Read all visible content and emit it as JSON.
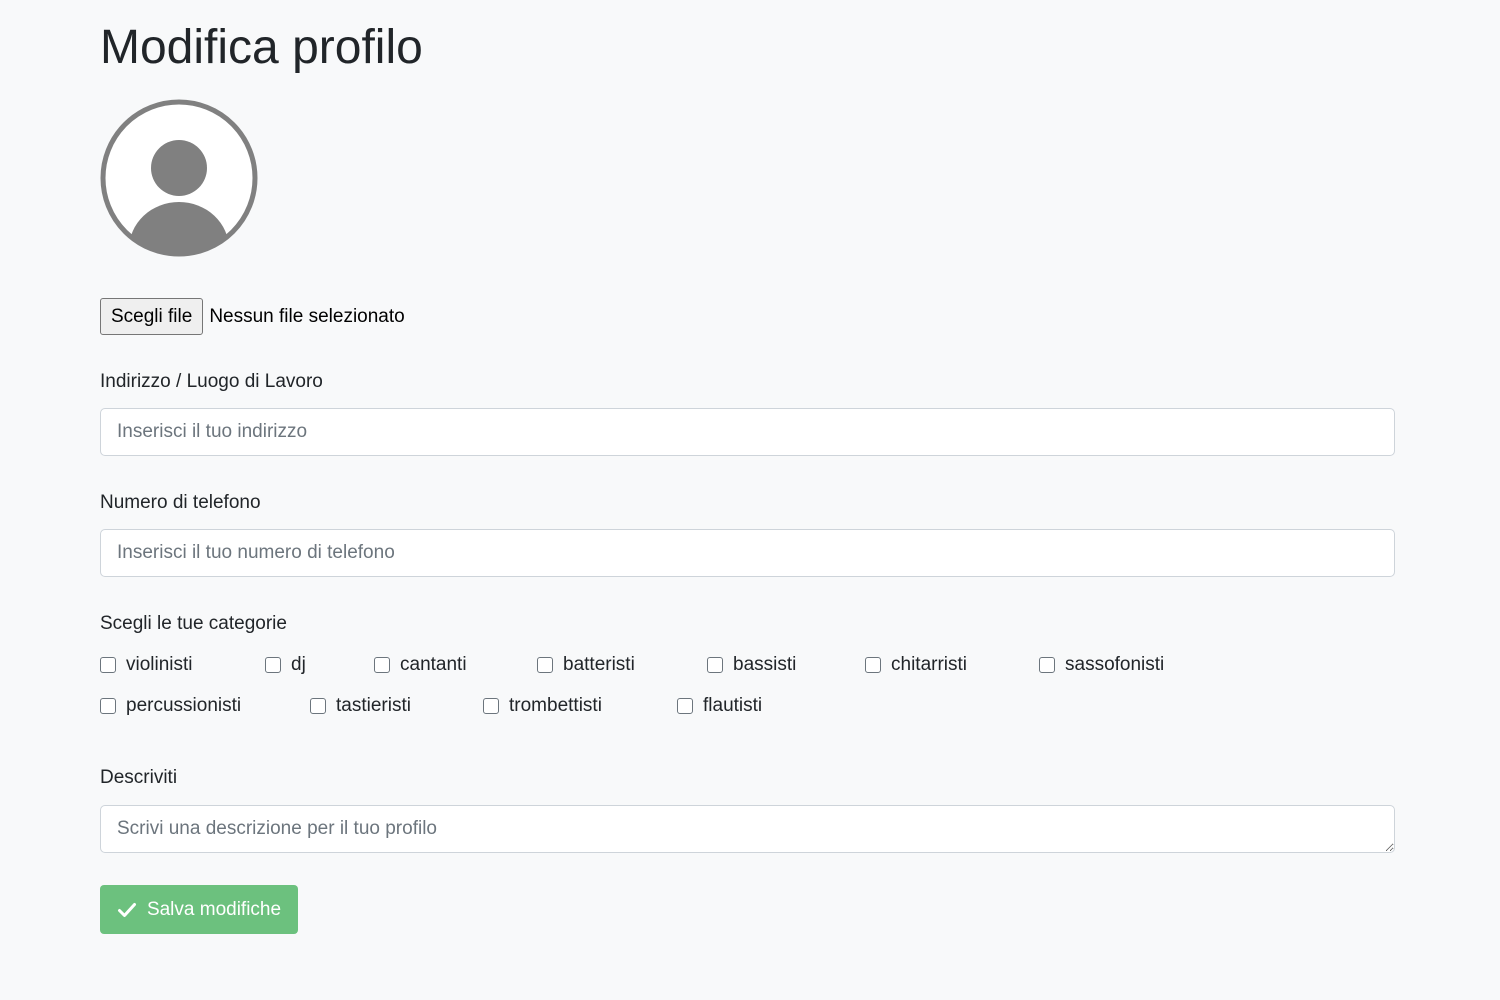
{
  "page": {
    "title": "Modifica profilo"
  },
  "avatar": {
    "icon": "user-avatar-icon"
  },
  "file_upload": {
    "button_label": "Scegli file",
    "status_text": "Nessun file selezionato"
  },
  "address": {
    "label": "Indirizzo / Luogo di Lavoro",
    "placeholder": "Inserisci il tuo indirizzo",
    "value": ""
  },
  "phone": {
    "label": "Numero di telefono",
    "placeholder": "Inserisci il tuo numero di telefono",
    "value": ""
  },
  "categories": {
    "label": "Scegli le tue categorie",
    "items": [
      {
        "label": "violinisti",
        "checked": false
      },
      {
        "label": "dj",
        "checked": false
      },
      {
        "label": "cantanti",
        "checked": false
      },
      {
        "label": "batteristi",
        "checked": false
      },
      {
        "label": "bassisti",
        "checked": false
      },
      {
        "label": "chitarristi",
        "checked": false
      },
      {
        "label": "sassofonisti",
        "checked": false
      },
      {
        "label": "percussionisti",
        "checked": false
      },
      {
        "label": "tastieristi",
        "checked": false
      },
      {
        "label": "trombettisti",
        "checked": false
      },
      {
        "label": "flautisti",
        "checked": false
      }
    ]
  },
  "description": {
    "label": "Descriviti",
    "placeholder": "Scrivi una descrizione per il tuo profilo",
    "value": ""
  },
  "save": {
    "label": "Salva modifiche",
    "icon": "check-icon",
    "color": "#6cc17e"
  }
}
